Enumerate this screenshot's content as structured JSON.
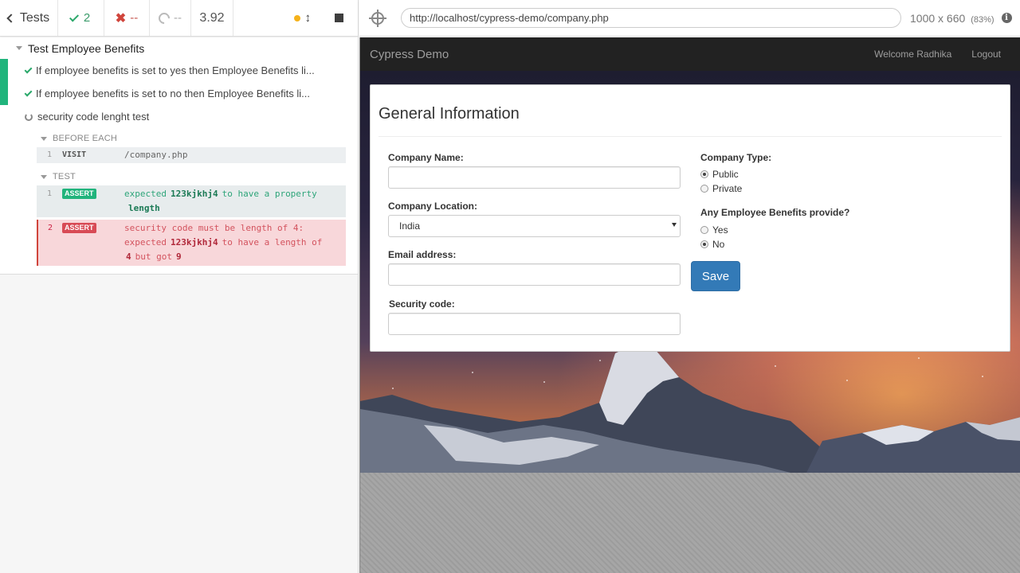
{
  "stats": {
    "tests_label": "Tests",
    "passed": "2",
    "failed": "--",
    "pending": "--",
    "duration": "3.92"
  },
  "suite": {
    "title": "Test Employee Benefits",
    "tests": [
      {
        "title": "If employee benefits is set to yes then Employee Benefits li...",
        "state": "passed"
      },
      {
        "title": "If employee benefits is set to no then Employee Benefits li...",
        "state": "passed"
      },
      {
        "title": "security code lenght test",
        "state": "running"
      }
    ],
    "before_each": {
      "label": "BEFORE EACH",
      "commands": [
        {
          "num": "1",
          "name": "VISIT",
          "message": "/company.php"
        }
      ]
    },
    "test_hook": {
      "label": "TEST",
      "commands": [
        {
          "num": "1",
          "name": "ASSERT",
          "parts": [
            "expected",
            "123kjkhj4",
            "to have a property",
            "length"
          ],
          "state": "passed"
        },
        {
          "num": "2",
          "name": "ASSERT",
          "parts": [
            "security code must be length of 4: expected",
            "123kjkhj4",
            "to have a length of",
            "4",
            "but got",
            "9"
          ],
          "state": "failed"
        }
      ]
    }
  },
  "aut": {
    "url": "http://localhost/cypress-demo/company.php",
    "viewport": "1000 x 660",
    "scale": "(83%)",
    "info_icon": "i"
  },
  "app": {
    "brand": "Cypress Demo",
    "nav": {
      "welcome": "Welcome Radhika",
      "logout": "Logout"
    },
    "panel_title": "General Information",
    "fields": {
      "company_name": {
        "label": "Company Name:",
        "value": ""
      },
      "company_location": {
        "label": "Company Location:",
        "value": "India"
      },
      "email": {
        "label": "Email address:",
        "value": ""
      },
      "security_code": {
        "label": "Security code:",
        "value": ""
      }
    },
    "company_type": {
      "label": "Company Type:",
      "options": [
        "Public",
        "Private"
      ],
      "selected": "Public"
    },
    "benefits": {
      "label": "Any Employee Benefits provide?",
      "options": [
        "Yes",
        "No"
      ],
      "selected": "No"
    },
    "save_label": "Save"
  },
  "colors": {
    "pass": "#21b47c",
    "fail": "#d84a55",
    "primary_button": "#337ab7",
    "navbar": "#222222"
  }
}
